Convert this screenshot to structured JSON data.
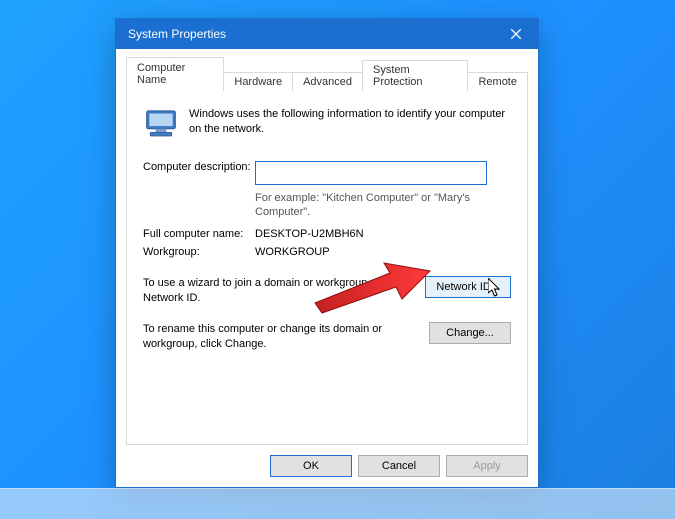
{
  "window": {
    "title": "System Properties",
    "tabs": [
      "Computer Name",
      "Hardware",
      "Advanced",
      "System Protection",
      "Remote"
    ],
    "intro": "Windows uses the following information to identify your computer on the network.",
    "desc_label": "Computer description:",
    "desc_value": "",
    "desc_hint": "For example: \"Kitchen Computer\" or \"Mary's Computer\".",
    "fullname_label": "Full computer name:",
    "fullname_value": "DESKTOP-U2MBH6N",
    "workgroup_label": "Workgroup:",
    "workgroup_value": "WORKGROUP",
    "networkid_msg": "To use a wizard to join a domain or workgroup, click Network ID.",
    "networkid_btn": "Network ID...",
    "change_msg": "To rename this computer or change its domain or workgroup, click Change.",
    "change_btn": "Change...",
    "ok": "OK",
    "cancel": "Cancel",
    "apply": "Apply"
  }
}
